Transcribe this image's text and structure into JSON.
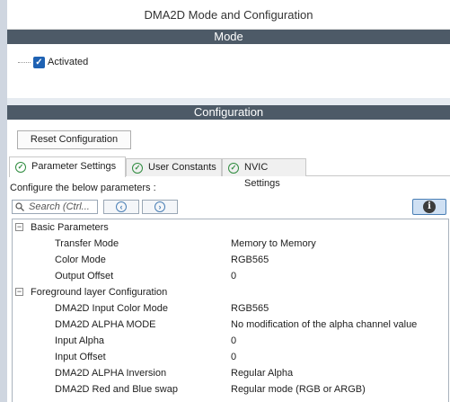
{
  "window": {
    "title": "DMA2D Mode and Configuration"
  },
  "mode": {
    "header": "Mode",
    "activated": {
      "label": "Activated",
      "checked": true
    }
  },
  "configuration": {
    "header": "Configuration",
    "reset_label": "Reset Configuration",
    "tabs": [
      {
        "label": "Parameter Settings",
        "active": true
      },
      {
        "label": "User Constants",
        "active": false
      },
      {
        "label": "NVIC Settings",
        "active": false
      }
    ],
    "instruction": "Configure the below parameters :",
    "search": {
      "placeholder": "Search (Ctrl..."
    },
    "groups": [
      {
        "label": "Basic Parameters",
        "expanded": true,
        "params": [
          {
            "name": "Transfer Mode",
            "value": "Memory to Memory"
          },
          {
            "name": "Color Mode",
            "value": "RGB565"
          },
          {
            "name": "Output Offset",
            "value": "0"
          }
        ]
      },
      {
        "label": "Foreground layer Configuration",
        "expanded": true,
        "params": [
          {
            "name": "DMA2D Input Color Mode",
            "value": "RGB565"
          },
          {
            "name": "DMA2D ALPHA MODE",
            "value": "No modification of the alpha channel value"
          },
          {
            "name": "Input Alpha",
            "value": "0"
          },
          {
            "name": "Input Offset",
            "value": "0"
          },
          {
            "name": "DMA2D ALPHA Inversion",
            "value": "Regular Alpha"
          },
          {
            "name": "DMA2D Red and Blue swap",
            "value": "Regular mode (RGB or ARGB)"
          }
        ]
      }
    ]
  },
  "colors": {
    "section_header": "#4d5a67",
    "check_blue": "#1f62b3",
    "tab_check_green": "#2e8b3e"
  },
  "icons": {
    "expander": "minus-box",
    "tab": "check-circle-icon",
    "search": "magnifier-icon",
    "prev": "chevron-left-icon",
    "next": "chevron-right-icon",
    "info": "info-icon"
  }
}
